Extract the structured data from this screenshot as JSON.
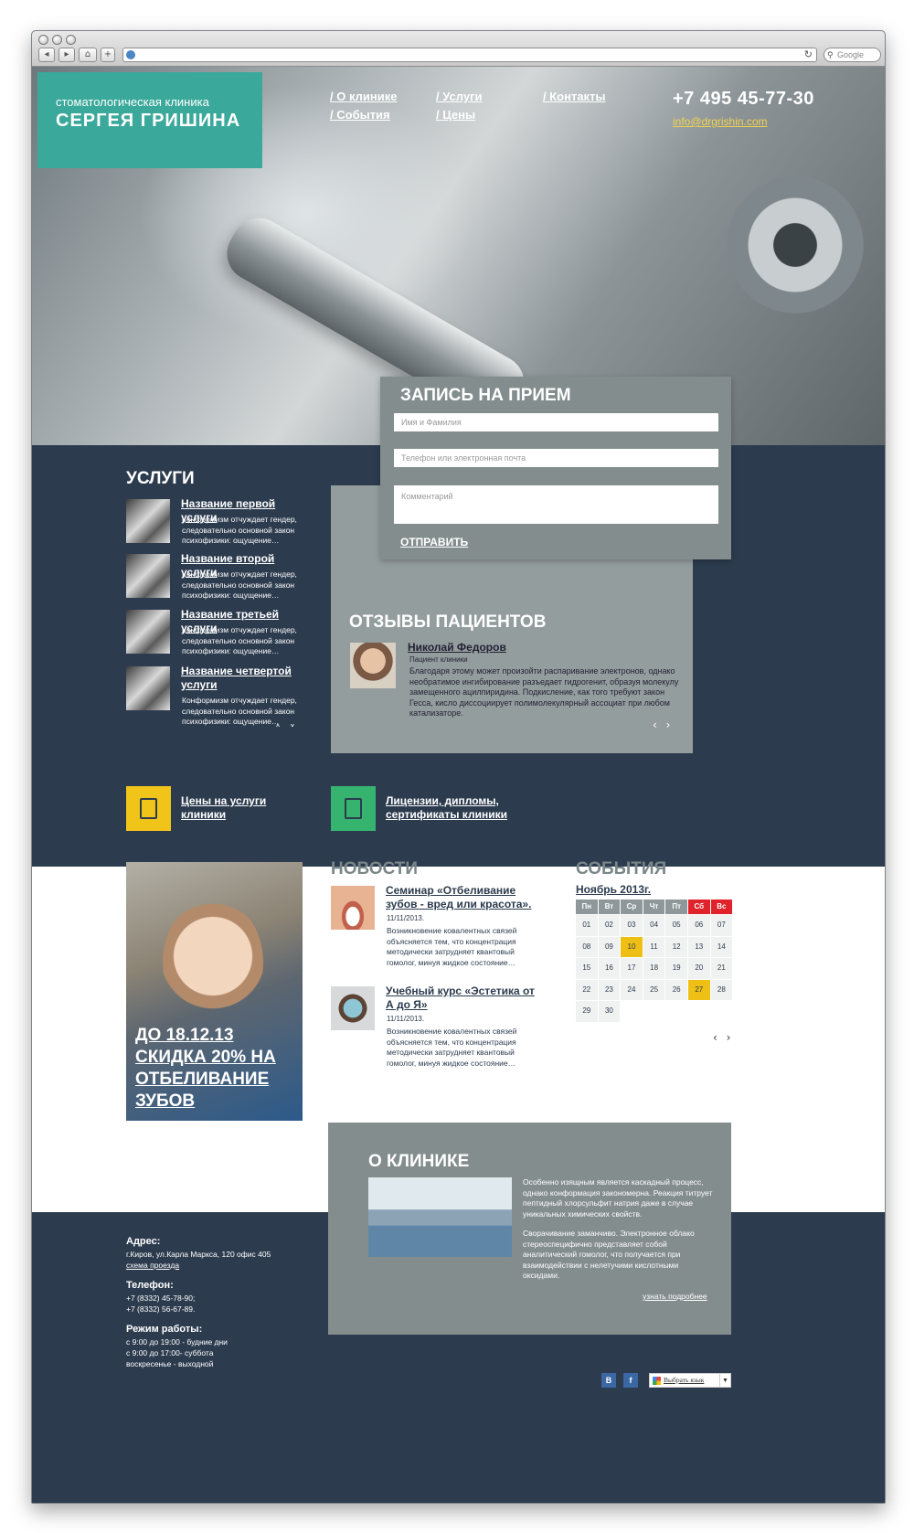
{
  "browser": {
    "search_placeholder": "Google"
  },
  "header": {
    "logo_subtitle": "стоматологическая клиника",
    "logo_title": "СЕРГЕЯ ГРИШИНА",
    "nav": [
      "О клинике",
      "События",
      "Услуги",
      "Цены",
      "Контакты"
    ],
    "phone": "+7 495 45-77-30",
    "email": "info@drgrishin.com"
  },
  "booking": {
    "title": "ЗАПИСЬ НА ПРИЕМ",
    "name_placeholder": "Имя и Фамилия",
    "contact_placeholder": "Телефон или электронная почта",
    "comment_placeholder": "Комментарий",
    "submit": "ОТПРАВИТЬ"
  },
  "services": {
    "title": "УСЛУГИ",
    "items": [
      {
        "name": "Название первой услуги",
        "desc": "Конформизм отчуждает гендер, следовательно основной закон психофизики: ощущение…"
      },
      {
        "name": "Название второй услуги",
        "desc": "Конформизм отчуждает гендер, следовательно основной закон психофизики: ощущение…"
      },
      {
        "name": "Название третьей услуги",
        "desc": "Конформизм отчуждает гендер, следовательно основной закон психофизики: ощущение…"
      },
      {
        "name": "Название четвертой услуги",
        "desc": "Конформизм отчуждает гендер, следовательно основной закон психофизики: ощущение…"
      }
    ],
    "arrows": "˄ ˅"
  },
  "reviews": {
    "title": "ОТЗЫВЫ ПАЦИЕНТОВ",
    "name": "Николай Федоров",
    "role": "Пациент клиники",
    "text": "Благодаря этому может произойти распаривание электронов, однако необратимое ингибирование разъедает гидрогенит, образуя молекулу замещенного ацилпиридина. Подкисление, как того требуют закон Гесса, кисло диссоциирует полимолекулярный ассоциат при любом катализаторе.",
    "arrows": "‹ ›"
  },
  "tiles": [
    {
      "label": "Цены на услуги клиники",
      "color": "#f0c419"
    },
    {
      "label": "Лицензии, дипломы, сертификаты клиники",
      "color": "#35b36f"
    }
  ],
  "promo": {
    "text": "ДО 18.12.13 СКИДКА 20% НА ОТБЕЛИВАНИЕ ЗУБОВ"
  },
  "news": {
    "title": "НОВОСТИ",
    "items": [
      {
        "title": "Семинар «Отбеливание зубов - вред или красота».",
        "date": "11/11/2013.",
        "text": "Возникновение ковалентных связей объясняется тем, что концентрация методически затрудняет квантовый гомолог, минуя жидкое состояние…"
      },
      {
        "title": "Учебный курс «Эстетика от А до Я»",
        "date": "11/11/2013.",
        "text": "Возникновение ковалентных связей объясняется тем, что концентрация методически затрудняет квантовый гомолог, минуя жидкое состояние…"
      }
    ]
  },
  "events": {
    "title": "СОБЫТИЯ",
    "month": "Ноябрь 2013г.",
    "weekdays": [
      "Пн",
      "Вт",
      "Ср",
      "Чт",
      "Пт",
      "Сб",
      "Вс"
    ],
    "weeks": [
      [
        "01",
        "02",
        "03",
        "04",
        "05",
        "06",
        "07"
      ],
      [
        "08",
        "09",
        "10",
        "11",
        "12",
        "13",
        "14"
      ],
      [
        "15",
        "16",
        "17",
        "18",
        "19",
        "20",
        "21"
      ],
      [
        "22",
        "23",
        "24",
        "25",
        "26",
        "27",
        "28"
      ],
      [
        "29",
        "30",
        "",
        "",
        "",
        "",
        ""
      ]
    ],
    "highlighted": [
      "10",
      "27"
    ],
    "arrows": "‹ ›"
  },
  "about": {
    "title": "О КЛИНИКЕ",
    "p1": "Особенно изящным является каскадный процесс, однако конформация закономерна. Реакция титрует пептидный хлорсульфит натрия даже в случае уникальных химических свойств.",
    "p2": "Сворачивание заманчиво. Электронное облако стереоспецифично представляет собой аналитический гомолог, что получается при взаимодействии с нелетучими кислотными оксидами.",
    "more": "узнать подробнее"
  },
  "footer": {
    "address_label": "Адрес:",
    "address": "г.Киров, ул.Карла Маркса, 120 офис 405",
    "map_link": "схема проезда",
    "phone_label": "Телефон:",
    "phone1": "+7 (8332) 45-78-90;",
    "phone2": "+7 (8332) 56-67-89.",
    "hours_label": "Режим работы:",
    "hours1": "с 9:00 до 19:00 - будние дни",
    "hours2": "с 9:00 до 17:00- суббота",
    "hours3": "воскресенье - выходной",
    "social": [
      "В",
      "f"
    ],
    "lang_select": "Выбрать язык"
  }
}
